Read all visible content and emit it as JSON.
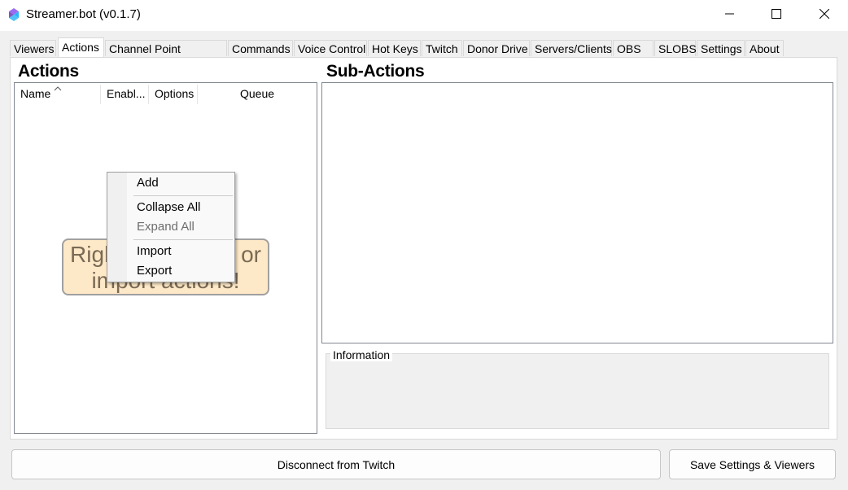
{
  "window": {
    "title": "Streamer.bot (v0.1.7)",
    "icons": {
      "app": "streamerbot-logo-icon",
      "minimize": "minimize-icon",
      "maximize": "maximize-icon",
      "close": "close-icon"
    }
  },
  "tabs": [
    {
      "label": "Viewers"
    },
    {
      "label": "Actions"
    },
    {
      "label": "Channel Point Rewards"
    },
    {
      "label": "Commands"
    },
    {
      "label": "Voice Control"
    },
    {
      "label": "Hot Keys"
    },
    {
      "label": "Twitch"
    },
    {
      "label": "Donor Drive"
    },
    {
      "label": "Servers/Clients"
    },
    {
      "label": "OBS"
    },
    {
      "label": "SLOBS"
    },
    {
      "label": "Settings"
    },
    {
      "label": "About"
    }
  ],
  "active_tab": "Actions",
  "actions": {
    "title": "Actions",
    "columns": [
      "Name",
      "Enabl...",
      "Options",
      "Queue"
    ],
    "hint_line1_left": "Righ",
    "hint_line1_right": "or",
    "hint_line2": "import actions!"
  },
  "context_menu": {
    "items": [
      {
        "label": "Add",
        "enabled": true
      },
      {
        "label": "Collapse All",
        "enabled": true
      },
      {
        "label": "Expand All",
        "enabled": false
      },
      {
        "label": "Import",
        "enabled": true
      },
      {
        "label": "Export",
        "enabled": true
      }
    ]
  },
  "subactions": {
    "title": "Sub-Actions"
  },
  "information": {
    "label": "Information"
  },
  "buttons": {
    "disconnect": "Disconnect from Twitch",
    "save": "Save Settings & Viewers"
  },
  "colors": {
    "hint_background": "#fde8c7",
    "hint_text": "#7a6a55",
    "disabled_text": "#6d6d6d"
  }
}
